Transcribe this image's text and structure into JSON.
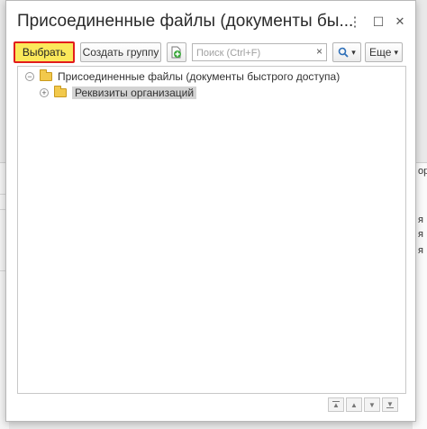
{
  "window": {
    "title": "Присоединенные файлы (документы бы...",
    "menu_icon": "⋮",
    "maximize_icon": "☐",
    "close_icon": "✕"
  },
  "toolbar": {
    "select_label": "Выбрать",
    "create_group_label": "Создать группу",
    "add_icon": "+",
    "search_placeholder": "Поиск (Ctrl+F)",
    "search_clear": "×",
    "search_icon": "🔍",
    "dropdown_icon": "▾",
    "more_label": "Еще",
    "more_dropdown": "▾"
  },
  "tree": {
    "root": {
      "toggle": "−",
      "label": "Присоединенные файлы (документы быстрого доступа)"
    },
    "children": [
      {
        "toggle": "+",
        "label": "Реквизиты организаций"
      }
    ]
  },
  "nav": {
    "first": "▲",
    "up": "▲",
    "down": "▼",
    "last": "▼"
  },
  "background": {
    "right_fragments": [
      "ор",
      "я",
      "я",
      "я"
    ]
  }
}
